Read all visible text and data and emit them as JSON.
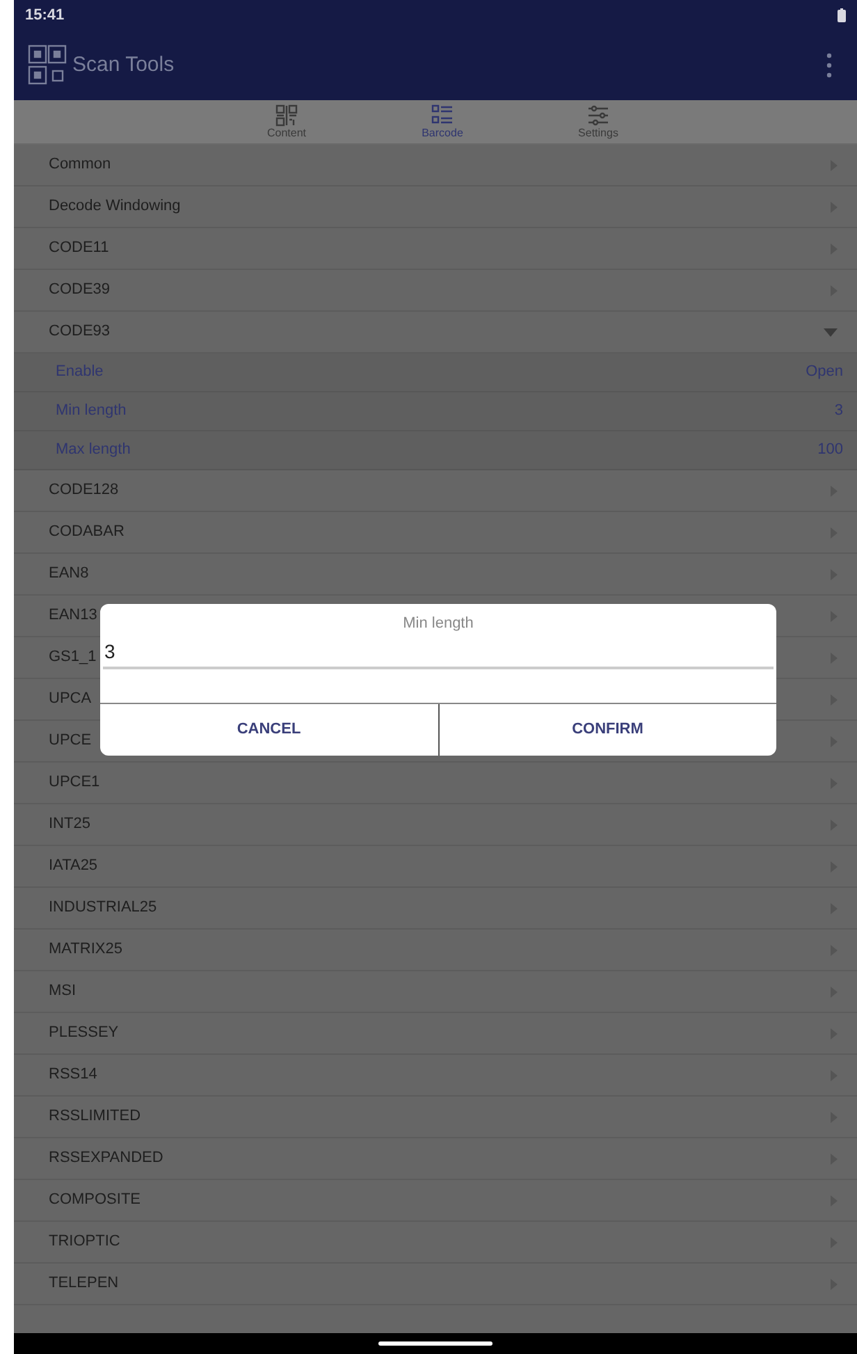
{
  "status_bar": {
    "time": "15:41"
  },
  "app_bar": {
    "title": "Scan Tools"
  },
  "tabs": [
    {
      "label": "Content",
      "selected": false,
      "kind": "content"
    },
    {
      "label": "Barcode",
      "selected": true,
      "kind": "barcode"
    },
    {
      "label": "Settings",
      "selected": false,
      "kind": "settings"
    }
  ],
  "list": [
    {
      "label": "Common",
      "expanded": false
    },
    {
      "label": "Decode Windowing",
      "expanded": false
    },
    {
      "label": "CODE11",
      "expanded": false
    },
    {
      "label": "CODE39",
      "expanded": false
    },
    {
      "label": "CODE93",
      "expanded": true,
      "children": [
        {
          "label": "Enable",
          "value": "Open"
        },
        {
          "label": "Min length",
          "value": "3"
        },
        {
          "label": "Max length",
          "value": "100"
        }
      ]
    },
    {
      "label": "CODE128",
      "expanded": false
    },
    {
      "label": "CODABAR",
      "expanded": false
    },
    {
      "label": "EAN8",
      "expanded": false
    },
    {
      "label": "EAN13",
      "expanded": false
    },
    {
      "label": "GS1_1",
      "expanded": false
    },
    {
      "label": "UPCA",
      "expanded": false
    },
    {
      "label": "UPCE",
      "expanded": false
    },
    {
      "label": "UPCE1",
      "expanded": false
    },
    {
      "label": "INT25",
      "expanded": false
    },
    {
      "label": "IATA25",
      "expanded": false
    },
    {
      "label": "INDUSTRIAL25",
      "expanded": false
    },
    {
      "label": "MATRIX25",
      "expanded": false
    },
    {
      "label": "MSI",
      "expanded": false
    },
    {
      "label": "PLESSEY",
      "expanded": false
    },
    {
      "label": "RSS14",
      "expanded": false
    },
    {
      "label": "RSSLIMITED",
      "expanded": false
    },
    {
      "label": "RSSEXPANDED",
      "expanded": false
    },
    {
      "label": "COMPOSITE",
      "expanded": false
    },
    {
      "label": "TRIOPTIC",
      "expanded": false
    },
    {
      "label": "TELEPEN",
      "expanded": false
    }
  ],
  "dialog": {
    "title": "Min length",
    "value": "3",
    "buttons": [
      "CANCEL",
      "CONFIRM"
    ]
  }
}
